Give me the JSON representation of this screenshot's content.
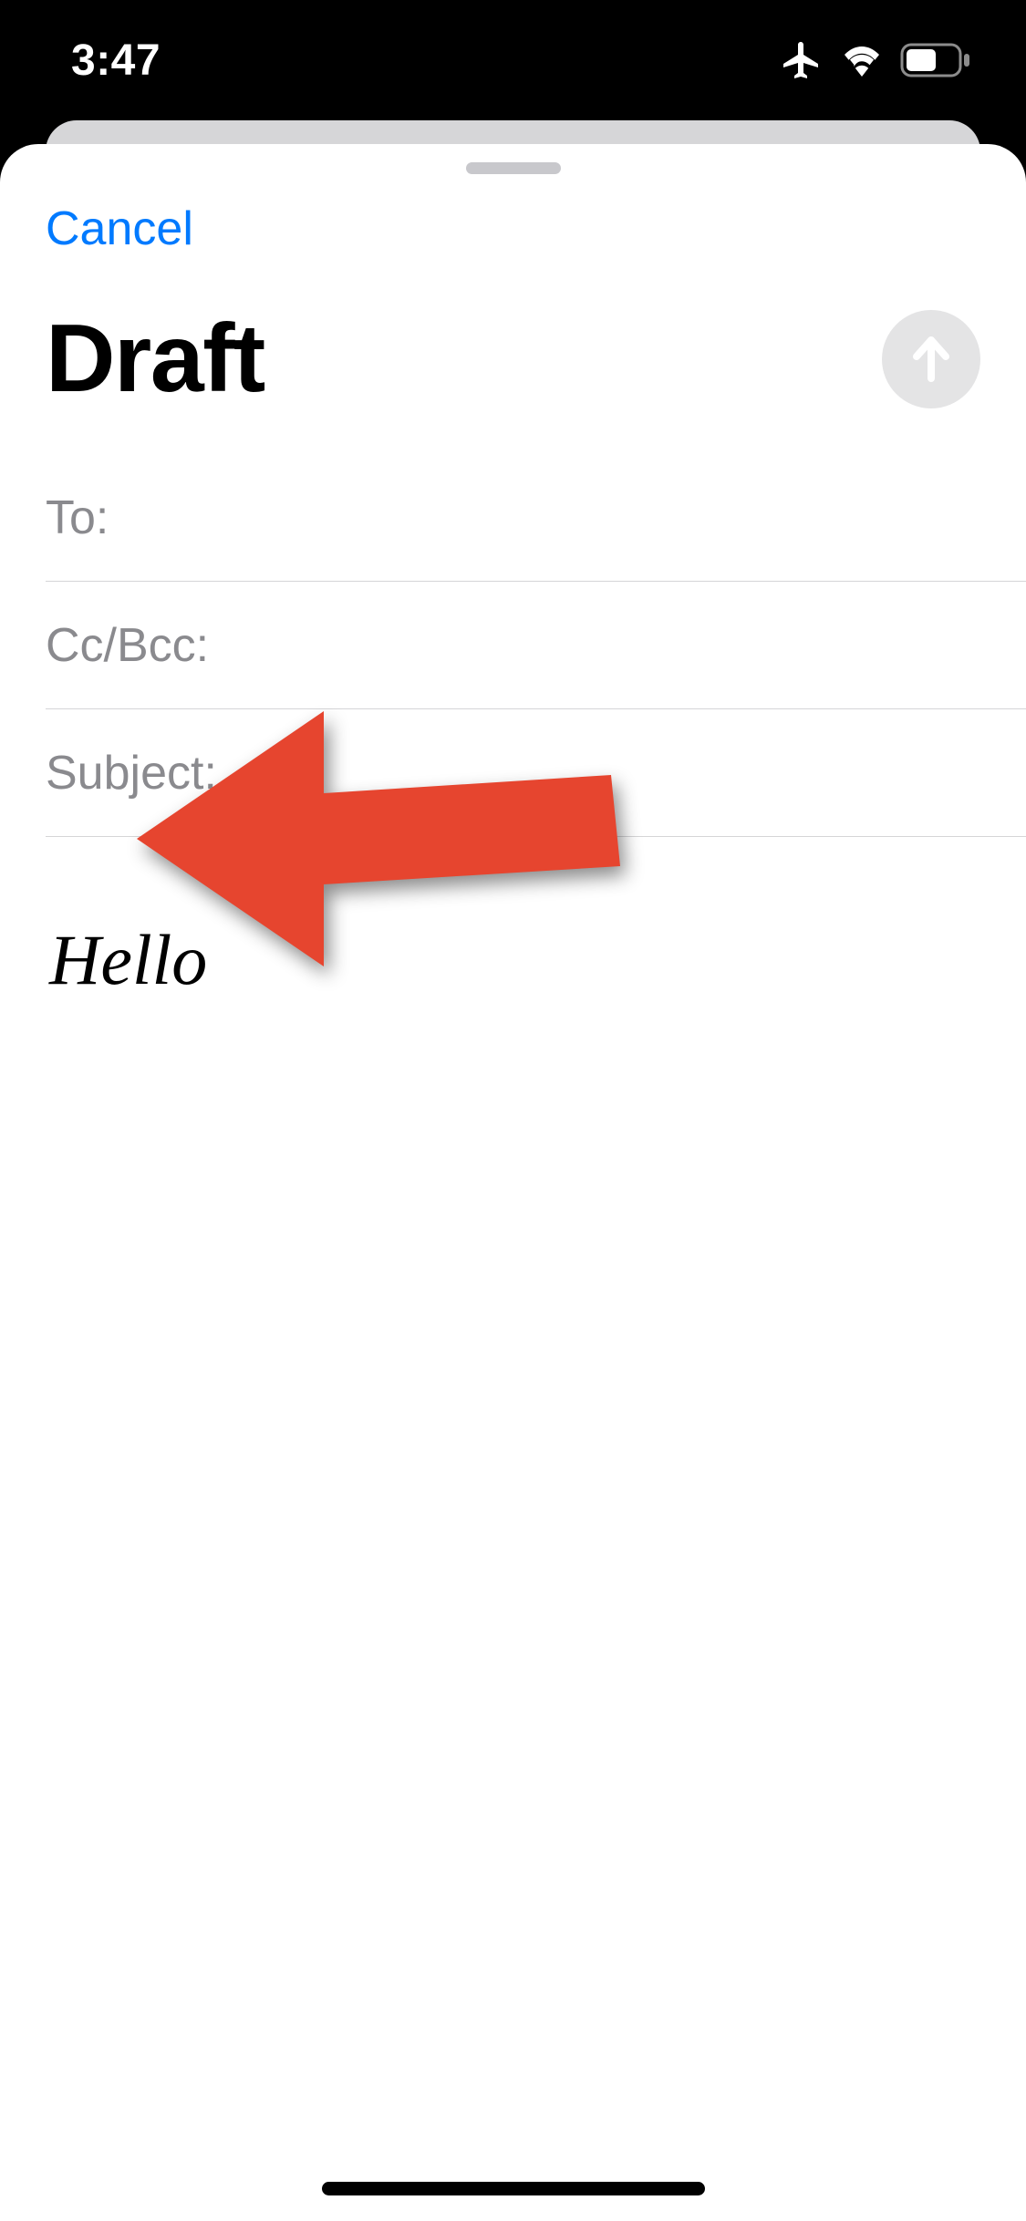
{
  "status": {
    "time": "3:47"
  },
  "nav": {
    "cancel_label": "Cancel"
  },
  "compose": {
    "title": "Draft",
    "fields": {
      "to_label": "To:",
      "to_value": "",
      "ccbcc_label": "Cc/Bcc:",
      "ccbcc_value": "",
      "subject_label": "Subject:",
      "subject_value": ""
    },
    "body": "Hello"
  },
  "colors": {
    "accent": "#007aff",
    "annotation_arrow": "#e6452f"
  }
}
